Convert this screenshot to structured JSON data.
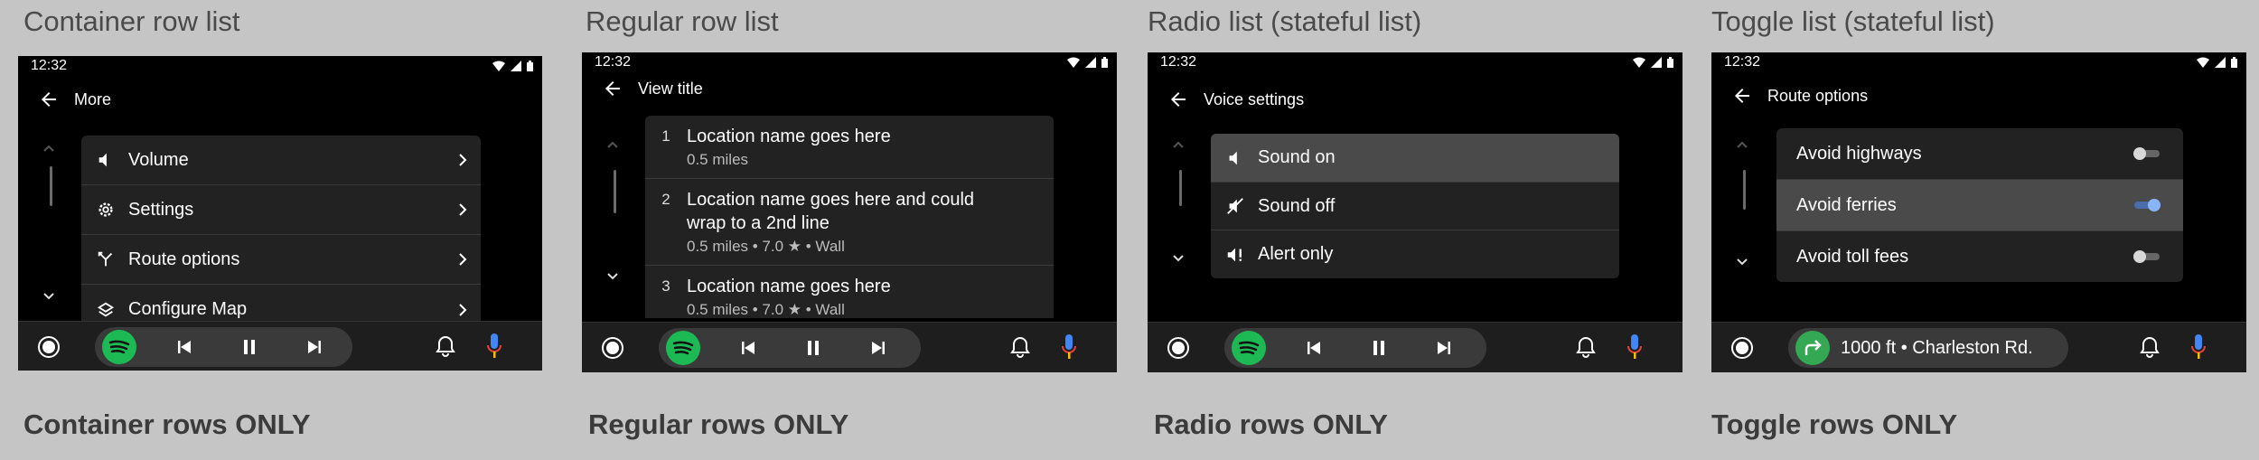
{
  "panels": [
    {
      "title": "Container row list",
      "caption": "Container rows ONLY"
    },
    {
      "title": "Regular row list",
      "caption": "Regular rows ONLY"
    },
    {
      "title": "Radio list (stateful list)",
      "caption": "Radio rows ONLY"
    },
    {
      "title": "Toggle list (stateful list)",
      "caption": "Toggle rows ONLY"
    }
  ],
  "status": {
    "time": "12:32"
  },
  "container": {
    "header": "More",
    "items": [
      {
        "label": "Volume",
        "icon": "volume-icon"
      },
      {
        "label": "Settings",
        "icon": "gear-icon"
      },
      {
        "label": "Route options",
        "icon": "route-icon"
      },
      {
        "label": "Configure Map",
        "icon": "layers-icon"
      }
    ]
  },
  "regular": {
    "header": "View title",
    "items": [
      {
        "num": "1",
        "title": "Location name goes here",
        "sub": "0.5 miles"
      },
      {
        "num": "2",
        "title": "Location name goes here and could wrap to a 2nd line",
        "sub": "0.5 miles • 7.0  ★  • Wall"
      },
      {
        "num": "3",
        "title": "Location name goes here",
        "sub": "0.5 miles • 7.0  ★  • Wall"
      }
    ]
  },
  "radio": {
    "header": "Voice settings",
    "items": [
      {
        "label": "Sound on",
        "icon": "sound-on-icon",
        "selected": true
      },
      {
        "label": "Sound off",
        "icon": "sound-off-icon",
        "selected": false
      },
      {
        "label": "Alert only",
        "icon": "alert-only-icon",
        "selected": false
      }
    ]
  },
  "toggle": {
    "header": "Route options",
    "items": [
      {
        "label": "Avoid highways",
        "on": false
      },
      {
        "label": "Avoid ferries",
        "on": true
      },
      {
        "label": "Avoid toll fees",
        "on": false
      }
    ],
    "nav_text": "1000 ft • Charleston Rd."
  },
  "colors": {
    "spotify": "#1db954",
    "toggle_on": "#8ab4f8",
    "nav_green": "#34a853",
    "selected_row": "#4a4a4a"
  }
}
